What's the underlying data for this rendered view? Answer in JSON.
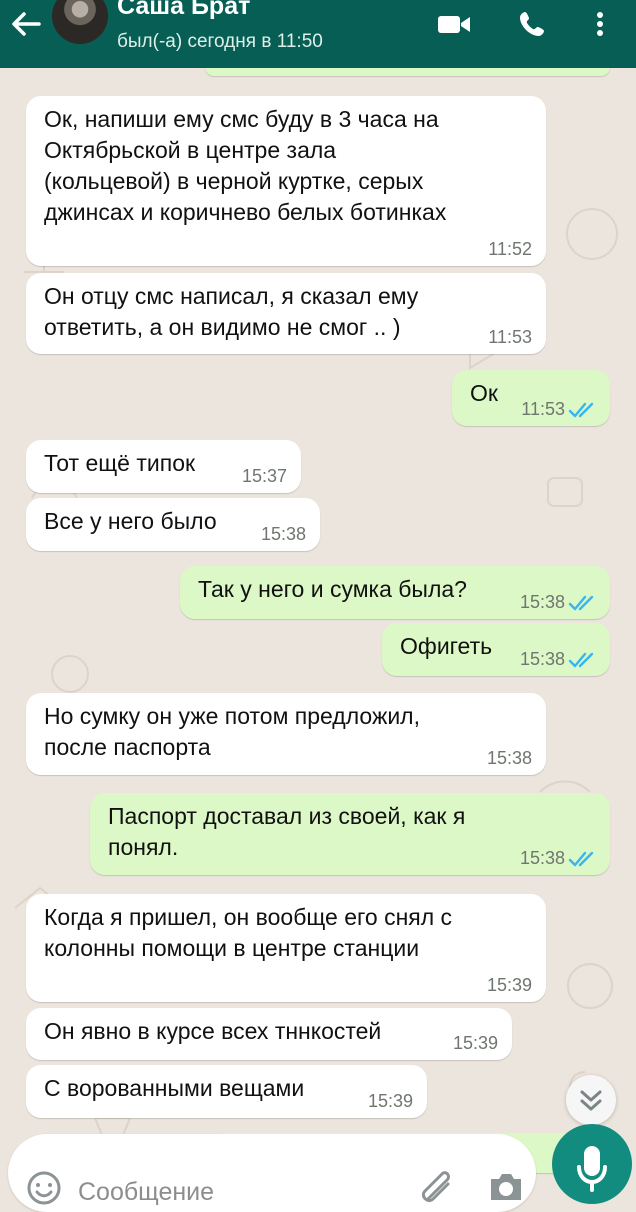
{
  "header": {
    "contact_name": "Саша Брат",
    "status": "был(-а) сегодня в 11:50",
    "back_icon": "arrow-left-icon",
    "actions": [
      "video-call-icon",
      "phone-icon",
      "more-vert-icon"
    ]
  },
  "messages": [
    {
      "direction": "in",
      "text": "Ок, напиши ему смс буду в 3 часа на\nОктябрьской в центре зала\n(кольцевой) в черной куртке, серых\nджинсах и коричнево белых ботинках",
      "time": "11:52"
    },
    {
      "direction": "in",
      "text": "Он отцу смс написал, я сказал ему\nответить, а он видимо не смог .. )",
      "time": "11:53"
    },
    {
      "direction": "out",
      "text": "Ок",
      "time": "11:53",
      "status": "read"
    },
    {
      "direction": "in",
      "text": "Тот ещё типок",
      "time": "15:37"
    },
    {
      "direction": "in",
      "text": "Все у него было",
      "time": "15:38"
    },
    {
      "direction": "out",
      "text": "Так у него и сумка была?",
      "time": "15:38",
      "status": "read"
    },
    {
      "direction": "out",
      "text": "Офигеть",
      "time": "15:38",
      "status": "read"
    },
    {
      "direction": "in",
      "text": "Но сумку он уже потом предложил,\nпосле паспорта",
      "time": "15:38"
    },
    {
      "direction": "out",
      "text": "Паспорт доставал из своей, как я\nпонял.",
      "time": "15:38",
      "status": "read"
    },
    {
      "direction": "in",
      "text": "Когда я пришел, он вообще его снял с\nколонны помощи в центре станции",
      "time": "15:39"
    },
    {
      "direction": "in",
      "text": "Он явно в курсе всех тннкостей",
      "time": "15:39"
    },
    {
      "direction": "in",
      "text": "С ворованными вещами",
      "time": "15:39"
    }
  ],
  "composer": {
    "placeholder": "Сообщение",
    "value": "",
    "icons": [
      "emoji-icon",
      "attach-icon",
      "camera-icon",
      "microphone-icon"
    ]
  },
  "scroll_down_icon": "double-chevron-down-icon",
  "colors": {
    "header": "#075e54",
    "wallpaper": "#ece5dd",
    "incoming_bubble": "#ffffff",
    "outgoing_bubble": "#dcf8c6",
    "read_ticks": "#34b7f1",
    "mic_button": "#128c7e"
  }
}
